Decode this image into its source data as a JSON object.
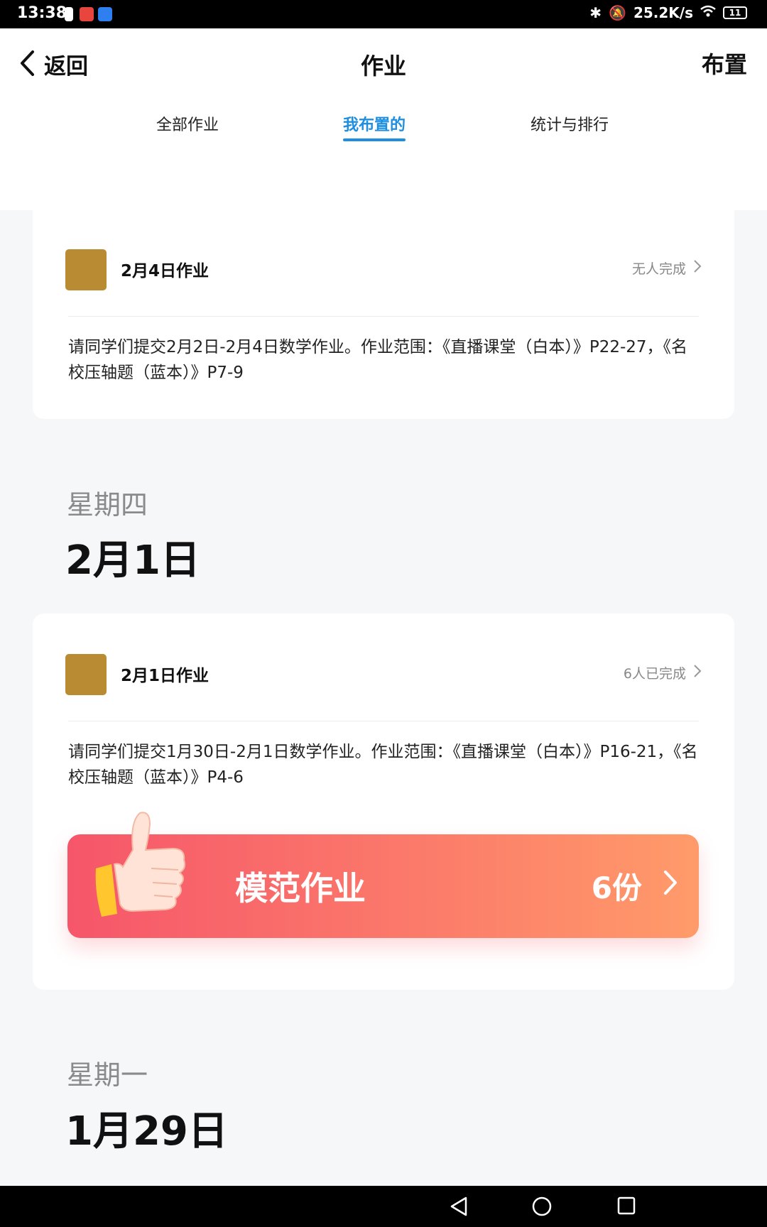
{
  "status_bar": {
    "time": "13:38",
    "net_speed": "25.2K/s",
    "battery": "11"
  },
  "header": {
    "back_label": "返回",
    "title": "作业",
    "assign_label": "布置"
  },
  "tabs": [
    {
      "label": "全部作业",
      "active": false
    },
    {
      "label": "我布置的",
      "active": true
    },
    {
      "label": "统计与排行",
      "active": false
    }
  ],
  "colors": {
    "accent": "#1e8fe0",
    "avatar": "#b98b32",
    "banner_start": "#f6566a",
    "banner_end": "#ff9b6a"
  },
  "groups": [
    {
      "card": {
        "title": "2月4日作业",
        "status": "无人完成",
        "description": "请同学们提交2月2日-2月4日数学作业。作业范围：《直播课堂（白本）》P22-27，《名校压轴题（蓝本）》P7-9"
      }
    },
    {
      "weekday": "星期四",
      "date": "2月1日",
      "card": {
        "title": "2月1日作业",
        "status": "6人已完成",
        "description": "请同学们提交1月30日-2月1日数学作业。作业范围：《直播课堂（白本）》P16-21，《名校压轴题（蓝本）》P4-6",
        "model_banner": {
          "label": "模范作业",
          "count": "6份"
        }
      }
    },
    {
      "weekday": "星期一",
      "date": "1月29日"
    }
  ]
}
